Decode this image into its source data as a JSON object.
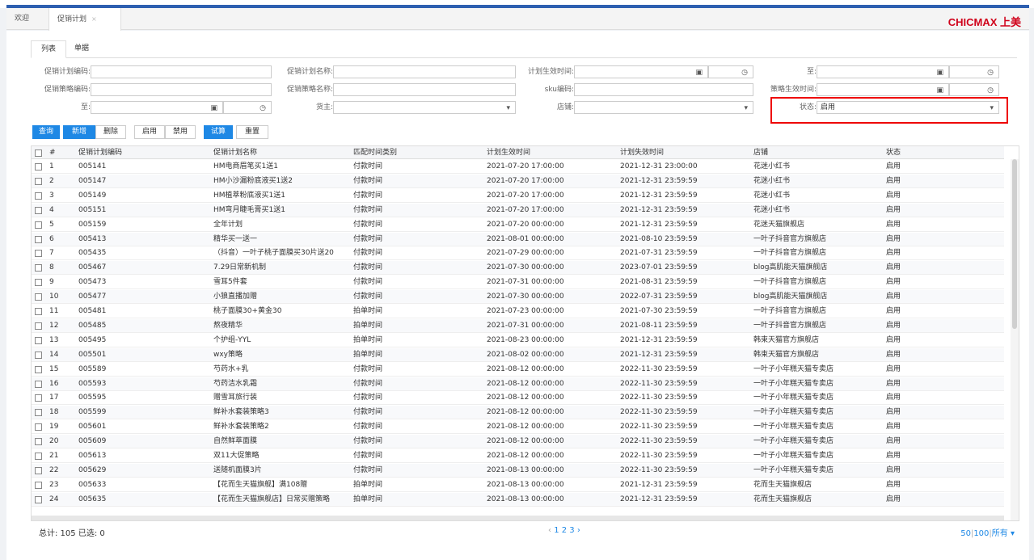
{
  "tabs": {
    "welcome": "欢迎",
    "active": "促销计划",
    "close": "×"
  },
  "brand": "CHICMAX 上美",
  "subtabs": {
    "list": "列表",
    "doc": "单据"
  },
  "filters": {
    "plan_code": "促销计划编码:",
    "plan_name": "促销计划名称:",
    "plan_effective": "计划生效时间:",
    "to1": "至:",
    "strategy_code": "促销策略编码:",
    "strategy_name": "促销策略名称:",
    "sku": "sku编码:",
    "strategy_effective": "策略生效时间:",
    "to2": "至:",
    "owner": "货主:",
    "store": "店铺:",
    "status": "状态:",
    "status_value": "启用"
  },
  "icons": {
    "calendar": "calendar-icon",
    "clock": "clock-icon",
    "caret": "caret-down-icon"
  },
  "buttons": {
    "query": "查询",
    "add": "新增",
    "delete": "删除",
    "enable": "启用",
    "disable": "禁用",
    "trial": "试算",
    "reset": "重置"
  },
  "columns": [
    "#",
    "促销计划编码",
    "促销计划名称",
    "匹配时间类别",
    "计划生效时间",
    "计划失效时间",
    "店铺",
    "状态"
  ],
  "rows": [
    [
      "1",
      "005141",
      "HM电商眉笔买1送1",
      "付款时间",
      "2021-07-20 17:00:00",
      "2021-12-31 23:00:00",
      "花迷小红书",
      "启用"
    ],
    [
      "2",
      "005147",
      "HM小沙漏粉底液买1送2",
      "付款时间",
      "2021-07-20 17:00:00",
      "2021-12-31 23:59:59",
      "花迷小红书",
      "启用"
    ],
    [
      "3",
      "005149",
      "HM植萃粉底液买1送1",
      "付款时间",
      "2021-07-20 17:00:00",
      "2021-12-31 23:59:59",
      "花迷小红书",
      "启用"
    ],
    [
      "4",
      "005151",
      "HM弯月睫毛膏买1送1",
      "付款时间",
      "2021-07-20 17:00:00",
      "2021-12-31 23:59:59",
      "花迷小红书",
      "启用"
    ],
    [
      "5",
      "005159",
      "全年计划",
      "付款时间",
      "2021-07-20 00:00:00",
      "2021-12-31 23:59:59",
      "花迷天猫旗舰店",
      "启用"
    ],
    [
      "6",
      "005413",
      "精华买一送一",
      "付款时间",
      "2021-08-01 00:00:00",
      "2021-08-10 23:59:59",
      "一叶子抖音官方旗舰店",
      "启用"
    ],
    [
      "7",
      "005435",
      "（抖音）一叶子桃子面膜买30片送20",
      "付款时间",
      "2021-07-29 00:00:00",
      "2021-07-31 23:59:59",
      "一叶子抖音官方旗舰店",
      "启用"
    ],
    [
      "8",
      "005467",
      "7.29日常新机制",
      "付款时间",
      "2021-07-30 00:00:00",
      "2023-07-01 23:59:59",
      "blog高肌能天猫旗舰店",
      "启用"
    ],
    [
      "9",
      "005473",
      "雪耳5件套",
      "付款时间",
      "2021-07-31 00:00:00",
      "2021-08-31 23:59:59",
      "一叶子抖音官方旗舰店",
      "启用"
    ],
    [
      "10",
      "005477",
      "小狼直播加赠",
      "付款时间",
      "2021-07-30 00:00:00",
      "2022-07-31 23:59:59",
      "blog高肌能天猫旗舰店",
      "启用"
    ],
    [
      "11",
      "005481",
      "桃子面膜30+黄金30",
      "拍单时间",
      "2021-07-23 00:00:00",
      "2021-07-30 23:59:59",
      "一叶子抖音官方旗舰店",
      "启用"
    ],
    [
      "12",
      "005485",
      "熬夜精华",
      "拍单时间",
      "2021-07-31 00:00:00",
      "2021-08-11 23:59:59",
      "一叶子抖音官方旗舰店",
      "启用"
    ],
    [
      "13",
      "005495",
      "个护组-YYL",
      "拍单时间",
      "2021-08-23 00:00:00",
      "2021-12-31 23:59:59",
      "韩束天猫官方旗舰店",
      "启用"
    ],
    [
      "14",
      "005501",
      "wxy策略",
      "拍单时间",
      "2021-08-02 00:00:00",
      "2021-12-31 23:59:59",
      "韩束天猫官方旗舰店",
      "启用"
    ],
    [
      "15",
      "005589",
      "芍药水+乳",
      "付款时间",
      "2021-08-12 00:00:00",
      "2022-11-30 23:59:59",
      "一叶子小年糕天猫专卖店",
      "启用"
    ],
    [
      "16",
      "005593",
      "芍药洁水乳霜",
      "付款时间",
      "2021-08-12 00:00:00",
      "2022-11-30 23:59:59",
      "一叶子小年糕天猫专卖店",
      "启用"
    ],
    [
      "17",
      "005595",
      "赠雪耳旅行装",
      "付款时间",
      "2021-08-12 00:00:00",
      "2022-11-30 23:59:59",
      "一叶子小年糕天猫专卖店",
      "启用"
    ],
    [
      "18",
      "005599",
      "鲜补水套装策略3",
      "付款时间",
      "2021-08-12 00:00:00",
      "2022-11-30 23:59:59",
      "一叶子小年糕天猫专卖店",
      "启用"
    ],
    [
      "19",
      "005601",
      "鲜补水套装策略2",
      "付款时间",
      "2021-08-12 00:00:00",
      "2022-11-30 23:59:59",
      "一叶子小年糕天猫专卖店",
      "启用"
    ],
    [
      "20",
      "005609",
      "自然鲜萃面膜",
      "付款时间",
      "2021-08-12 00:00:00",
      "2022-11-30 23:59:59",
      "一叶子小年糕天猫专卖店",
      "启用"
    ],
    [
      "21",
      "005613",
      "双11大促策略",
      "付款时间",
      "2021-08-12 00:00:00",
      "2022-11-30 23:59:59",
      "一叶子小年糕天猫专卖店",
      "启用"
    ],
    [
      "22",
      "005629",
      "送随机面膜3片",
      "付款时间",
      "2021-08-13 00:00:00",
      "2022-11-30 23:59:59",
      "一叶子小年糕天猫专卖店",
      "启用"
    ],
    [
      "23",
      "005633",
      "【花而生天猫旗舰】满108赠",
      "拍单时间",
      "2021-08-13 00:00:00",
      "2021-12-31 23:59:59",
      "花而生天猫旗舰店",
      "启用"
    ],
    [
      "24",
      "005635",
      "【花而生天猫旗舰店】日常买赠策略",
      "拍单时间",
      "2021-08-13 00:00:00",
      "2021-12-31 23:59:59",
      "花而生天猫旗舰店",
      "启用"
    ]
  ],
  "footer": {
    "total": "总计: 105 已选: 0",
    "prev": "‹",
    "pages": "1 2 3",
    "next": "›",
    "size50": "50",
    "size100": "100",
    "sizeAll": "所有",
    "sizeCaret": "▾"
  },
  "colors": {
    "accent": "#1e88e5",
    "brand": "#d0021b",
    "highlight": "#e00000"
  }
}
